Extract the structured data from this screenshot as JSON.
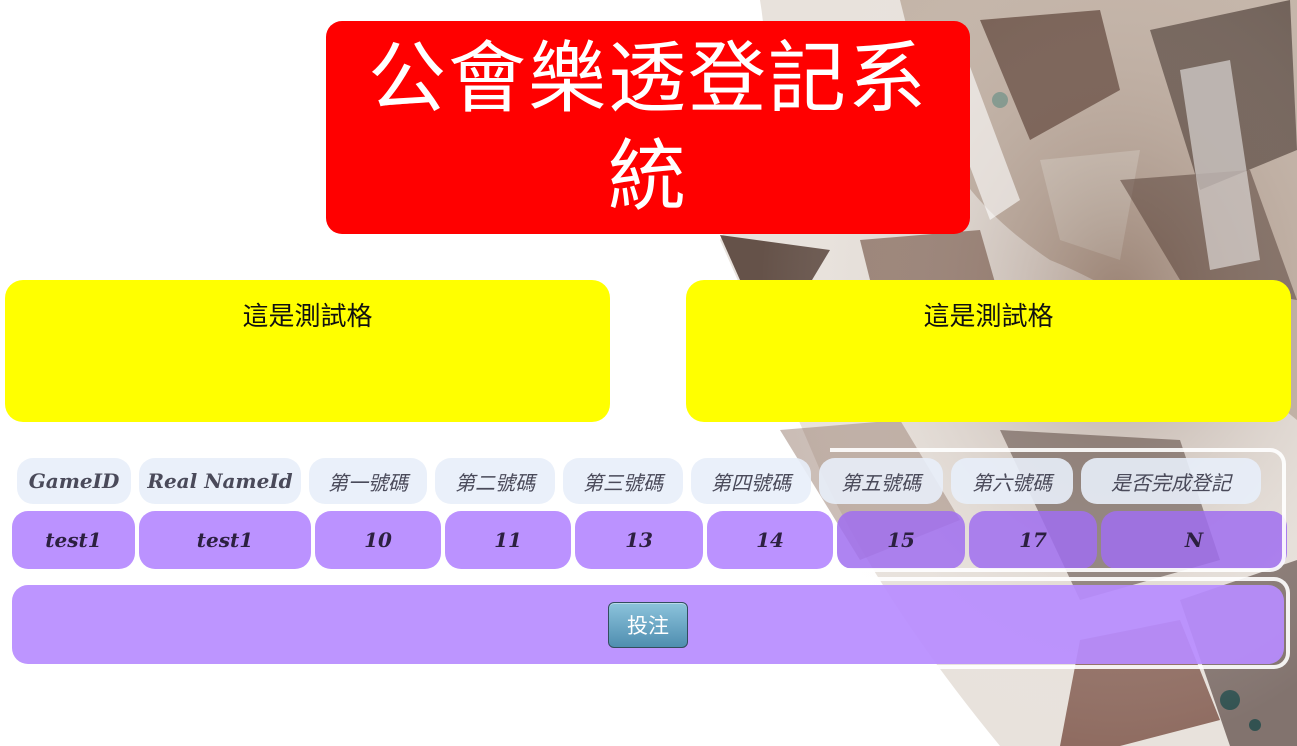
{
  "header": {
    "title": "公會樂透登記系統",
    "title_color": "#ff0000"
  },
  "panels": [
    {
      "label": "這是測試格",
      "color": "#ffff00"
    },
    {
      "label": "這是測試格",
      "color": "#ffff00"
    }
  ],
  "table": {
    "columns": [
      "GameID",
      "Real NameId",
      "第一號碼",
      "第二號碼",
      "第三號碼",
      "第四號碼",
      "第五號碼",
      "第六號碼",
      "是否完成登記"
    ],
    "rows": [
      [
        "test1",
        "test1",
        "10",
        "11",
        "13",
        "14",
        "15",
        "17",
        "N"
      ]
    ],
    "row_color": "#b78cff"
  },
  "form": {
    "submit_label": "投注"
  }
}
